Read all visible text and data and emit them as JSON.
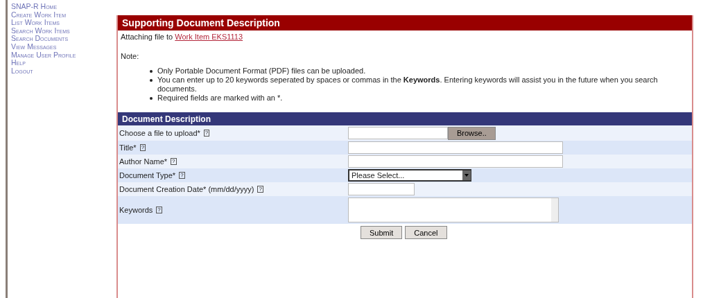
{
  "nav": [
    {
      "label": "SNAP-R Home"
    },
    {
      "label": "Create Work Item"
    },
    {
      "label": "List Work Items"
    },
    {
      "label": "Search Work Items"
    },
    {
      "label": "Search Documents"
    },
    {
      "label": "View Messages"
    },
    {
      "label": "Manage User Profile"
    },
    {
      "label": "Help"
    },
    {
      "label": "Logout"
    }
  ],
  "panel": {
    "title": "Supporting Document Description",
    "attach_text": "Attaching file to",
    "attach_link": "Work Item EKS1113",
    "note_label": "Note:",
    "notes": [
      "Only Portable Document Format (PDF) files can be uploaded.",
      "You can enter up to 20 keywords seperated by spaces or commas in the **Keywords**. Entering keywords will assist you in the future when you search documents.",
      "Required fields are marked with an *."
    ]
  },
  "form": {
    "title": "Document Description",
    "fields": [
      {
        "kind": "file",
        "label": "Choose a file to upload*",
        "help": "?",
        "button": "Browse.."
      },
      {
        "kind": "text",
        "label": "Title*",
        "help": "?"
      },
      {
        "kind": "text",
        "label": "Author Name*",
        "help": "?"
      },
      {
        "kind": "select",
        "label": "Document Type*",
        "help": "?",
        "value": "Please Select..."
      },
      {
        "kind": "date",
        "label": "Document Creation Date* (mm/dd/yyyy)",
        "help": "?"
      },
      {
        "kind": "textarea",
        "label": "Keywords",
        "help": "?"
      }
    ],
    "buttons": [
      "Submit",
      "Cancel"
    ]
  }
}
